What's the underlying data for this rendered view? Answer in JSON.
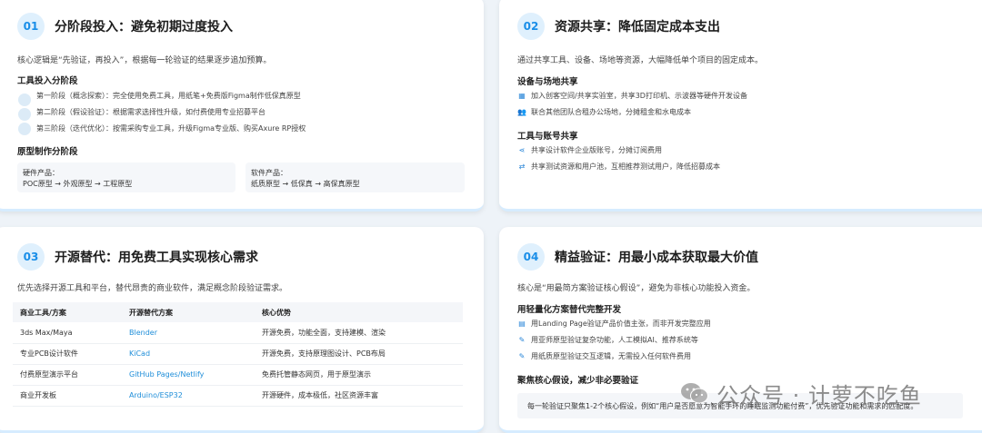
{
  "card1": {
    "num": "01",
    "title": "分阶段投入：避免初期过度投入",
    "intro": "核心逻辑是“先验证，再投入”，根据每一轮验证的结果逐步追加预算。",
    "tools_title": "工具投入分阶段",
    "steps": [
      "第一阶段（概念探索）：完全使用免费工具，用纸笔+免费版Figma制作低保真原型",
      "第二阶段（假设验证）：根据需求选择性升级，如付费使用专业招募平台",
      "第三阶段（迭代优化）：按需采购专业工具，升级Figma专业版、购买Axure RP授权"
    ],
    "proto_title": "原型制作分阶段",
    "hardware_label": "硬件产品：",
    "hardware_value": "POC原型 → 外观原型 → 工程原型",
    "software_label": "软件产品：",
    "software_value": "纸质原型 → 低保真 → 高保真原型"
  },
  "card2": {
    "num": "02",
    "title": "资源共享：降低固定成本支出",
    "intro": "通过共享工具、设备、场地等资源，大幅降低单个项目的固定成本。",
    "equip_title": "设备与场地共享",
    "equip_items": [
      "加入创客空间/共享实验室，共享3D打印机、示波器等硬件开发设备",
      "联合其他团队合租办公场地，分摊租金和水电成本"
    ],
    "tools_title": "工具与账号共享",
    "tools_items": [
      "共享设计软件企业版账号，分摊订阅费用",
      "共享测试资源和用户池，互相推荐测试用户，降低招募成本"
    ]
  },
  "card3": {
    "num": "03",
    "title": "开源替代：用免费工具实现核心需求",
    "intro": "优先选择开源工具和平台，替代昂贵的商业软件，满足概念阶段验证需求。",
    "headers": [
      "商业工具/方案",
      "开源替代方案",
      "核心优势"
    ],
    "rows": [
      [
        "3ds Max/Maya",
        "Blender",
        "开源免费，功能全面，支持建模、渲染"
      ],
      [
        "专业PCB设计软件",
        "KiCad",
        "开源免费，支持原理图设计、PCB布局"
      ],
      [
        "付费原型演示平台",
        "GitHub Pages/Netlify",
        "免费托管静态网页，用于原型演示"
      ],
      [
        "商业开发板",
        "Arduino/ESP32",
        "开源硬件，成本极低，社区资源丰富"
      ]
    ]
  },
  "card4": {
    "num": "04",
    "title": "精益验证：用最小成本获取最大价值",
    "intro": "核心是“用最简方案验证核心假设”，避免为非核心功能投入资金。",
    "light_title": "用轻量化方案替代完整开发",
    "light_items": [
      "用Landing Page验证产品价值主张，而非开发完整应用",
      "用亚师原型验证复杂功能，人工模拟AI、推荐系统等",
      "用纸质原型验证交互逻辑，无需投入任何软件费用"
    ],
    "focus_title": "聚焦核心假设，减少非必要验证",
    "focus_note": "每一轮验证只聚焦1-2个核心假设，例如“用户是否愿意为智能手环的睡眠监测功能付费”，优先验证功能和需求的匹配度。"
  },
  "watermark": "公众号 · 计萝不吃鱼",
  "colors": {
    "accent": "#1a8ee8",
    "badge_bg": "#dff0fd",
    "link": "#1f8ed9"
  }
}
